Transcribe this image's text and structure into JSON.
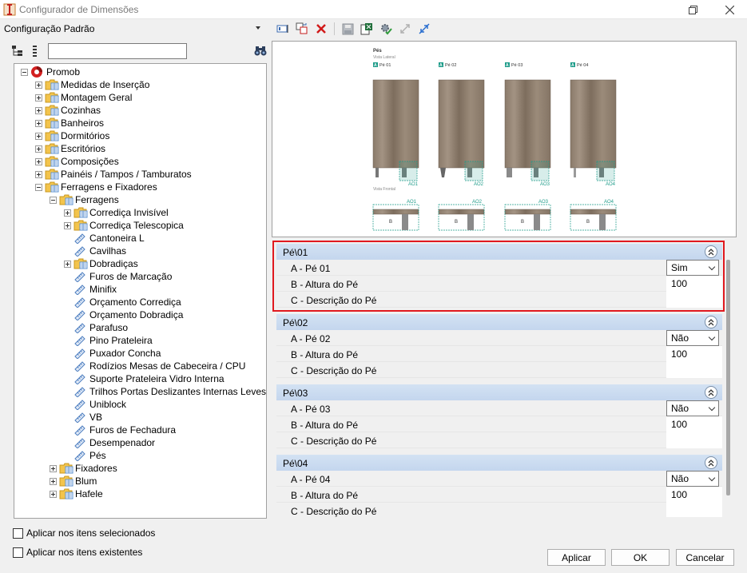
{
  "window": {
    "title": "Configurador de Dimensões"
  },
  "config": {
    "selected": "Configuração Padrão"
  },
  "search": {
    "value": ""
  },
  "tree": [
    {
      "label": "Promob",
      "level": 0,
      "expander": "minus",
      "icon": "promob-logo-icon"
    },
    {
      "label": "Medidas de Inserção",
      "level": 1,
      "expander": "plus",
      "icon": "folder-icon"
    },
    {
      "label": "Montagem Geral",
      "level": 1,
      "expander": "plus",
      "icon": "folder-icon"
    },
    {
      "label": "Cozinhas",
      "level": 1,
      "expander": "plus",
      "icon": "folder-icon"
    },
    {
      "label": "Banheiros",
      "level": 1,
      "expander": "plus",
      "icon": "folder-icon"
    },
    {
      "label": "Dormitórios",
      "level": 1,
      "expander": "plus",
      "icon": "folder-icon"
    },
    {
      "label": "Escritórios",
      "level": 1,
      "expander": "plus",
      "icon": "folder-icon"
    },
    {
      "label": "Composições",
      "level": 1,
      "expander": "plus",
      "icon": "folder-icon"
    },
    {
      "label": "Painéis / Tampos / Tamburatos",
      "level": 1,
      "expander": "plus",
      "icon": "folder-icon"
    },
    {
      "label": "Ferragens e Fixadores",
      "level": 1,
      "expander": "minus",
      "icon": "folder-icon"
    },
    {
      "label": "Ferragens",
      "level": 2,
      "expander": "minus",
      "icon": "folder-icon"
    },
    {
      "label": "Corrediça Invisível",
      "level": 3,
      "expander": "plus",
      "icon": "folder-icon"
    },
    {
      "label": "Corrediça Telescopica",
      "level": 3,
      "expander": "plus",
      "icon": "folder-icon"
    },
    {
      "label": "Cantoneira L",
      "level": 3,
      "expander": "none",
      "icon": "ruler-icon"
    },
    {
      "label": "Cavilhas",
      "level": 3,
      "expander": "none",
      "icon": "ruler-icon"
    },
    {
      "label": "Dobradiças",
      "level": 3,
      "expander": "plus",
      "icon": "folder-icon"
    },
    {
      "label": "Furos de Marcação",
      "level": 3,
      "expander": "none",
      "icon": "ruler-icon"
    },
    {
      "label": "Minifix",
      "level": 3,
      "expander": "none",
      "icon": "ruler-icon"
    },
    {
      "label": "Orçamento Corrediça",
      "level": 3,
      "expander": "none",
      "icon": "ruler-icon"
    },
    {
      "label": "Orçamento Dobradiça",
      "level": 3,
      "expander": "none",
      "icon": "ruler-icon"
    },
    {
      "label": "Parafuso",
      "level": 3,
      "expander": "none",
      "icon": "ruler-icon"
    },
    {
      "label": "Pino Prateleira",
      "level": 3,
      "expander": "none",
      "icon": "ruler-icon"
    },
    {
      "label": "Puxador Concha",
      "level": 3,
      "expander": "none",
      "icon": "ruler-icon"
    },
    {
      "label": "Rodízios Mesas de Cabeceira / CPU",
      "level": 3,
      "expander": "none",
      "icon": "ruler-icon"
    },
    {
      "label": "Suporte Prateleira Vidro Interna",
      "level": 3,
      "expander": "none",
      "icon": "ruler-icon"
    },
    {
      "label": "Trilhos Portas Deslizantes Internas Leves",
      "level": 3,
      "expander": "none",
      "icon": "ruler-icon"
    },
    {
      "label": "Uniblock",
      "level": 3,
      "expander": "none",
      "icon": "ruler-icon"
    },
    {
      "label": "VB",
      "level": 3,
      "expander": "none",
      "icon": "ruler-icon"
    },
    {
      "label": "Furos de Fechadura",
      "level": 3,
      "expander": "none",
      "icon": "ruler-icon"
    },
    {
      "label": "Desempenador",
      "level": 3,
      "expander": "none",
      "icon": "ruler-icon"
    },
    {
      "label": "Pés",
      "level": 3,
      "expander": "none",
      "icon": "ruler-icon"
    },
    {
      "label": "Fixadores",
      "level": 2,
      "expander": "plus",
      "icon": "folder-icon"
    },
    {
      "label": "Blum",
      "level": 2,
      "expander": "plus",
      "icon": "folder-icon"
    },
    {
      "label": "Hafele",
      "level": 2,
      "expander": "plus",
      "icon": "folder-icon"
    }
  ],
  "preview": {
    "title": "Pés",
    "side_view_label": "Vista Lateral",
    "front_view_label": "Vista Frontal",
    "feet": [
      {
        "badge": "A",
        "label": "Pé 01",
        "code": "AO1"
      },
      {
        "badge": "A",
        "label": "Pé 02",
        "code": "AO2"
      },
      {
        "badge": "A",
        "label": "Pé 03",
        "code": "AO3"
      },
      {
        "badge": "A",
        "label": "Pé 04",
        "code": "AO4"
      }
    ],
    "dim_label": "B"
  },
  "groups": [
    {
      "title": "Pé\\01",
      "rows": [
        {
          "name": "A - Pé 01",
          "type": "select",
          "value": "Sim"
        },
        {
          "name": "B - Altura do Pé",
          "type": "text",
          "value": "100"
        },
        {
          "name": "C - Descrição do Pé",
          "type": "text",
          "value": ""
        }
      ]
    },
    {
      "title": "Pé\\02",
      "rows": [
        {
          "name": "A - Pé 02",
          "type": "select",
          "value": "Não"
        },
        {
          "name": "B - Altura do Pé",
          "type": "text",
          "value": "100"
        },
        {
          "name": "C - Descrição do Pé",
          "type": "text",
          "value": ""
        }
      ]
    },
    {
      "title": "Pé\\03",
      "rows": [
        {
          "name": "A - Pé 03",
          "type": "select",
          "value": "Não"
        },
        {
          "name": "B - Altura do Pé",
          "type": "text",
          "value": "100"
        },
        {
          "name": "C - Descrição do Pé",
          "type": "text",
          "value": ""
        }
      ]
    },
    {
      "title": "Pé\\04",
      "rows": [
        {
          "name": "A - Pé 04",
          "type": "select",
          "value": "Não"
        },
        {
          "name": "B - Altura do Pé",
          "type": "text",
          "value": "100"
        },
        {
          "name": "C - Descrição do Pé",
          "type": "text",
          "value": ""
        }
      ]
    }
  ],
  "options": {
    "apply_selected": "Aplicar nos itens selecionados",
    "apply_existing": "Aplicar nos itens existentes"
  },
  "buttons": {
    "apply": "Aplicar",
    "ok": "OK",
    "cancel": "Cancelar"
  },
  "colors": {
    "highlight": "#e0191f",
    "group_header": "#c9daf0",
    "accent_teal": "#1f9c8a"
  }
}
